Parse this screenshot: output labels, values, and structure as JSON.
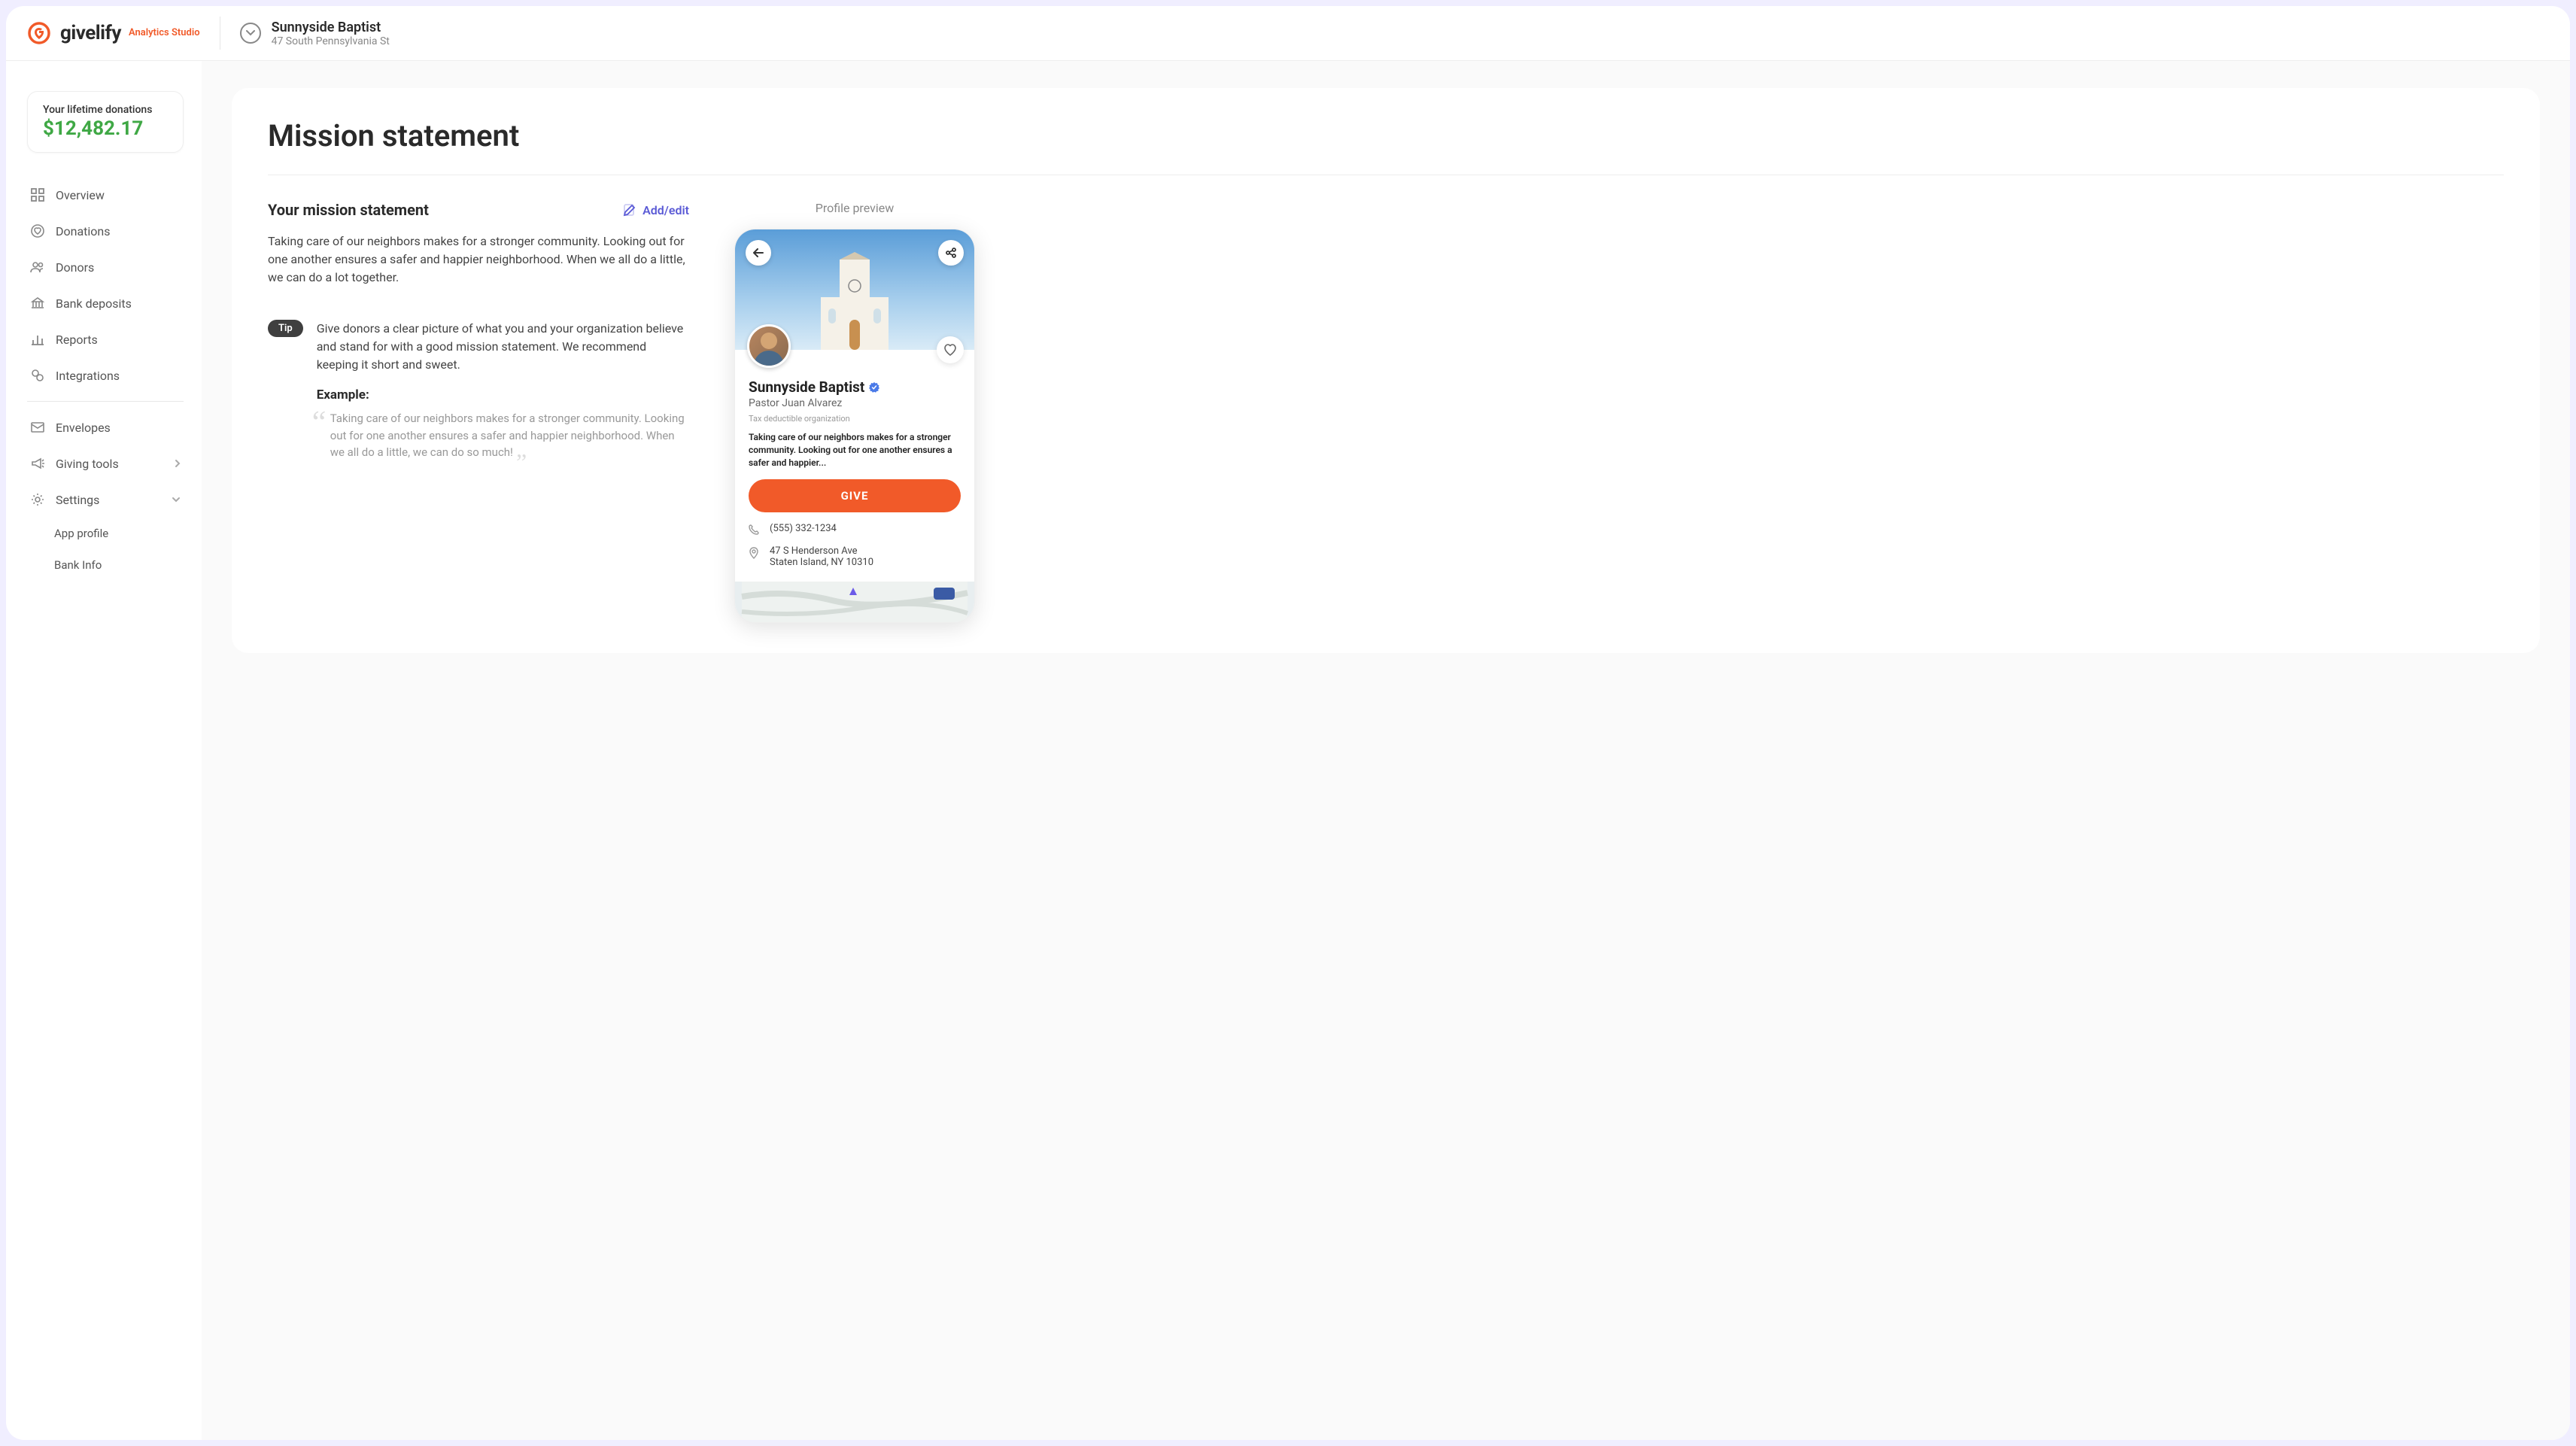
{
  "brand": {
    "name": "givelify",
    "studio": "Analytics Studio"
  },
  "org": {
    "name": "Sunnyside Baptist",
    "address": "47 South Pennsylvania St"
  },
  "lifetime": {
    "label": "Your lifetime donations",
    "amount": "$12,482.17"
  },
  "nav": {
    "overview": "Overview",
    "donations": "Donations",
    "donors": "Donors",
    "bank": "Bank deposits",
    "reports": "Reports",
    "integrations": "Integrations",
    "envelopes": "Envelopes",
    "giving_tools": "Giving tools",
    "settings": "Settings",
    "sub_app_profile": "App profile",
    "sub_bank_info": "Bank Info"
  },
  "page": {
    "title": "Mission statement",
    "section_title": "Your mission statement",
    "add_edit": "Add/edit",
    "mission_text": "Taking care of our neighbors makes for a stronger community. Looking out for one another ensures a safer and happier neighborhood. When we all do a little, we can do a lot together.",
    "tip_badge": "Tip",
    "tip_text": "Give donors a clear picture of what you and your organization believe and stand for with a good mission statement. We recommend keeping it short and sweet.",
    "example_label": "Example:",
    "example_quote": "Taking care of our neighbors makes for a stronger community. Looking out for one another ensures a safer and happier neighborhood. When we all do a little, we can do so much!"
  },
  "preview": {
    "label": "Profile preview",
    "name": "Sunnyside Baptist",
    "leader": "Pastor Juan Alvarez",
    "tax": "Tax deductible organization",
    "mission": "Taking care of our neighbors makes for a stronger community. Looking out for one another ensures a safer and happier...",
    "give": "GIVE",
    "phone": "(555) 332-1234",
    "addr1": "47 S Henderson Ave",
    "addr2": "Staten Island, NY 10310"
  }
}
